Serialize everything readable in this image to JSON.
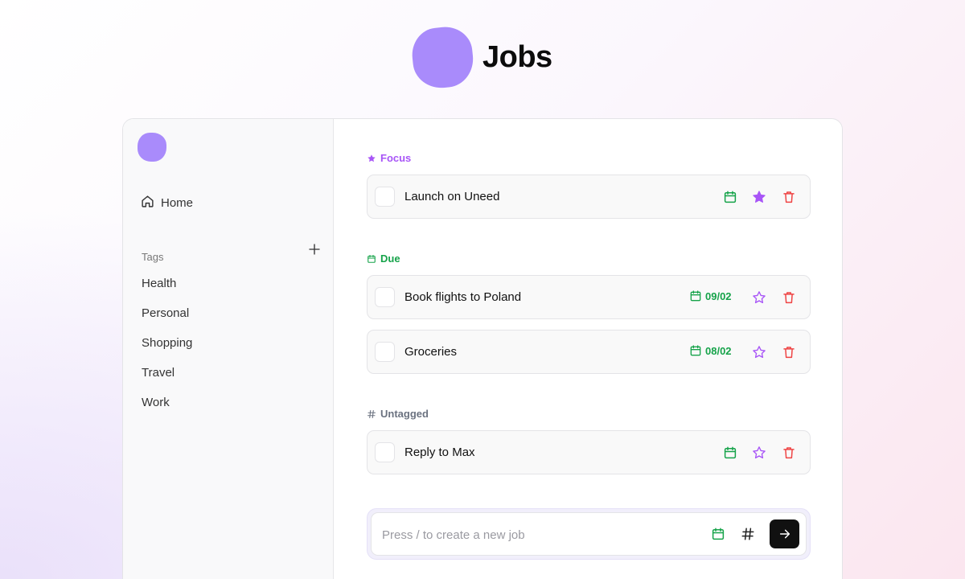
{
  "app": {
    "title": "Jobs"
  },
  "colors": {
    "brand": "#a98bfb",
    "focus": "#a855f7",
    "due": "#16a34a",
    "untagged": "#6b7280",
    "delete": "#ef4444"
  },
  "sidebar": {
    "home_label": "Home",
    "tags_heading": "Tags",
    "tags": [
      "Health",
      "Personal",
      "Shopping",
      "Travel",
      "Work"
    ]
  },
  "sections": {
    "focus": {
      "label": "Focus",
      "icon": "star-filled-icon",
      "tasks": [
        {
          "title": "Launch on Uneed",
          "starred": true,
          "due": ""
        }
      ]
    },
    "due": {
      "label": "Due",
      "icon": "calendar-icon",
      "tasks": [
        {
          "title": "Book flights to Poland",
          "starred": false,
          "due": "09/02"
        },
        {
          "title": "Groceries",
          "starred": false,
          "due": "08/02"
        }
      ]
    },
    "untagged": {
      "label": "Untagged",
      "icon": "hash-icon",
      "tasks": [
        {
          "title": "Reply to Max",
          "starred": false,
          "due": ""
        }
      ]
    }
  },
  "composer": {
    "placeholder": "Press / to create a new job",
    "value": ""
  }
}
